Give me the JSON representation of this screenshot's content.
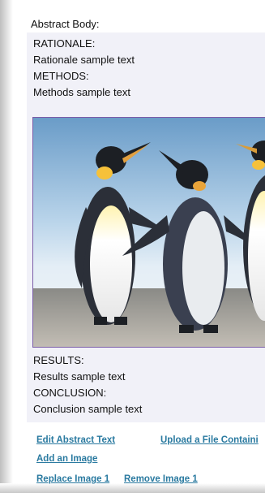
{
  "abstract": {
    "label": "Abstract Body:",
    "rationale_heading": "RATIONALE:",
    "rationale_text": "Rationale sample text",
    "methods_heading": "METHODS:",
    "methods_text": "Methods sample text",
    "results_heading": "RESULTS:",
    "results_text": "Results sample text",
    "conclusion_heading": "CONCLUSION:",
    "conclusion_text": "Conclusion sample text"
  },
  "image": {
    "subject": "penguins-photo"
  },
  "actions": {
    "edit_abstract": "Edit Abstract Text",
    "upload_file": "Upload a File Containi",
    "add_image": "Add an Image",
    "replace_image": "Replace Image 1",
    "remove_image": "Remove Image 1"
  },
  "colors": {
    "link": "#2a7aa0",
    "image_border": "#7a5ca8",
    "abstract_bg": "#f1f1f8"
  }
}
